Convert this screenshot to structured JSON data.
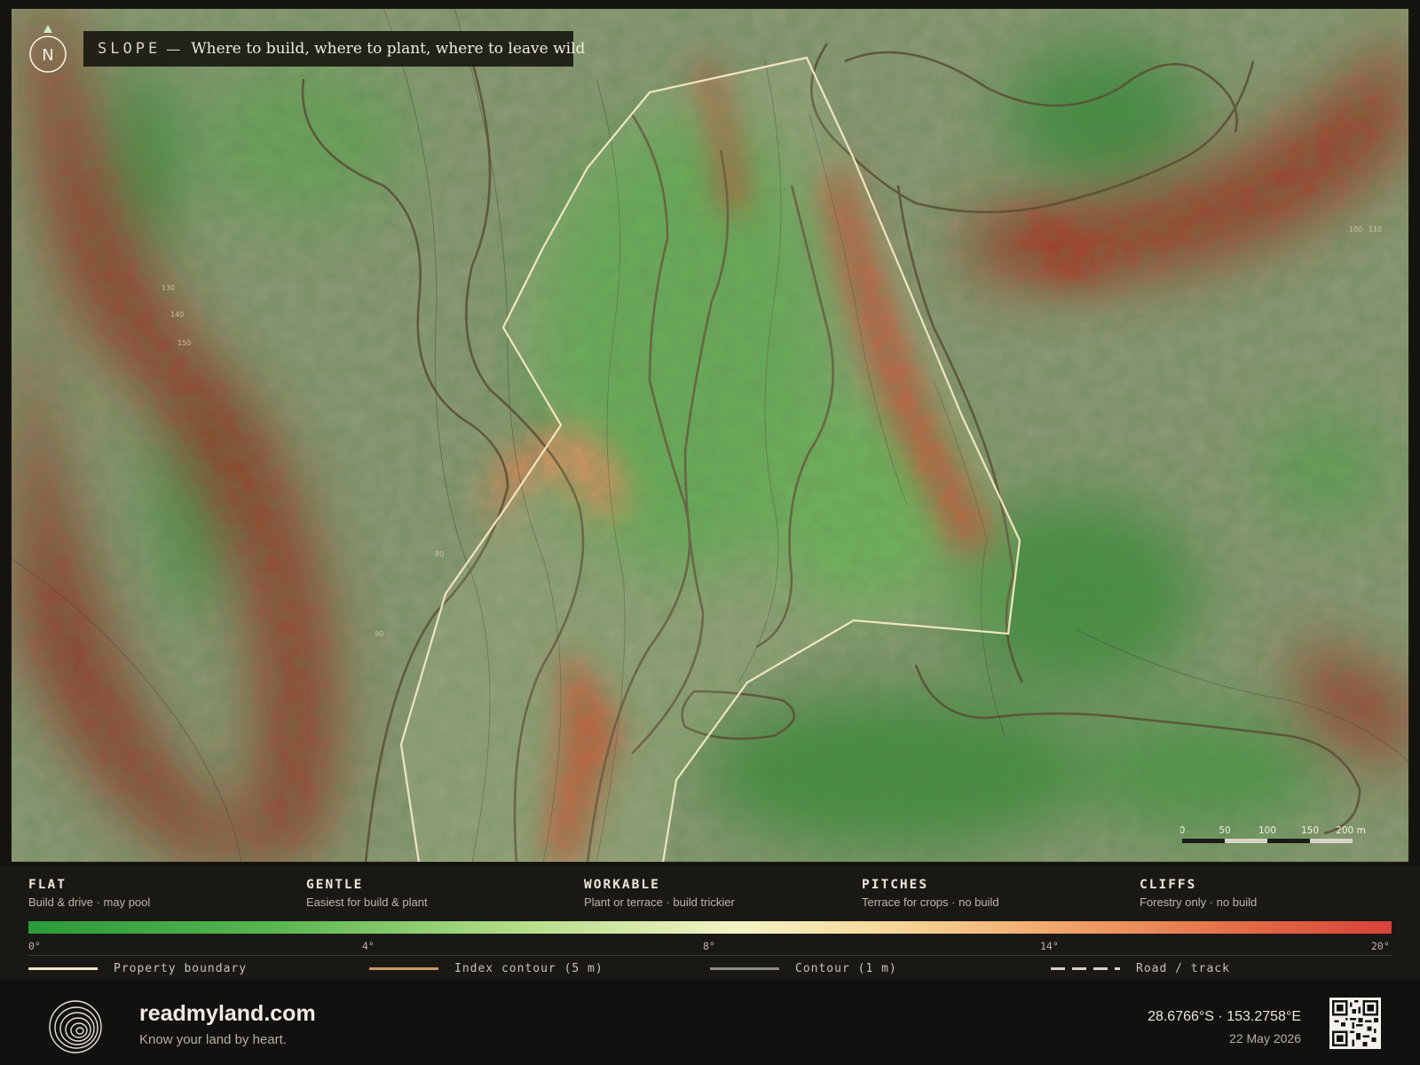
{
  "map": {
    "title_kicker": "SLOPE",
    "title_separator": "—",
    "title_text": "Where to build, where to plant, where to leave wild",
    "north_label": "N",
    "contour_labels": [
      "130",
      "140",
      "150",
      "80",
      "90",
      "100",
      "110"
    ],
    "scale_bar": {
      "ticks": [
        "0",
        "50",
        "100",
        "150",
        "200 m"
      ]
    }
  },
  "legend": {
    "categories": [
      {
        "name": "FLAT",
        "desc": "Build & drive · may pool",
        "color": "#2a9a3a"
      },
      {
        "name": "GENTLE",
        "desc": "Easiest for build & plant",
        "color": "#8fcb6e"
      },
      {
        "name": "WORKABLE",
        "desc": "Plant or terrace · build trickier",
        "color": "#f3f3c6"
      },
      {
        "name": "PITCHES",
        "desc": "Terrace for crops · no build",
        "color": "#f0a46a"
      },
      {
        "name": "CLIFFS",
        "desc": "Forestry only · no build",
        "color": "#d8423a"
      }
    ],
    "ticks": [
      "0°",
      "4°",
      "8°",
      "14°",
      "20°"
    ],
    "key_items": [
      {
        "label": "Property boundary",
        "style": "solid",
        "color": "#f1e4c0"
      },
      {
        "label": "Index contour (5 m)",
        "style": "solid",
        "color": "#c89a68"
      },
      {
        "label": "Contour (1 m)",
        "style": "solid",
        "color": "#8e8a80"
      },
      {
        "label": "Road / track",
        "style": "dashed",
        "color": "#d9d2c4"
      }
    ]
  },
  "footer": {
    "brand_name": "readmyland.com",
    "tagline": "Know your land by heart.",
    "coordinates": "28.6766°S · 153.2758°E",
    "date": "22 May 2026"
  }
}
